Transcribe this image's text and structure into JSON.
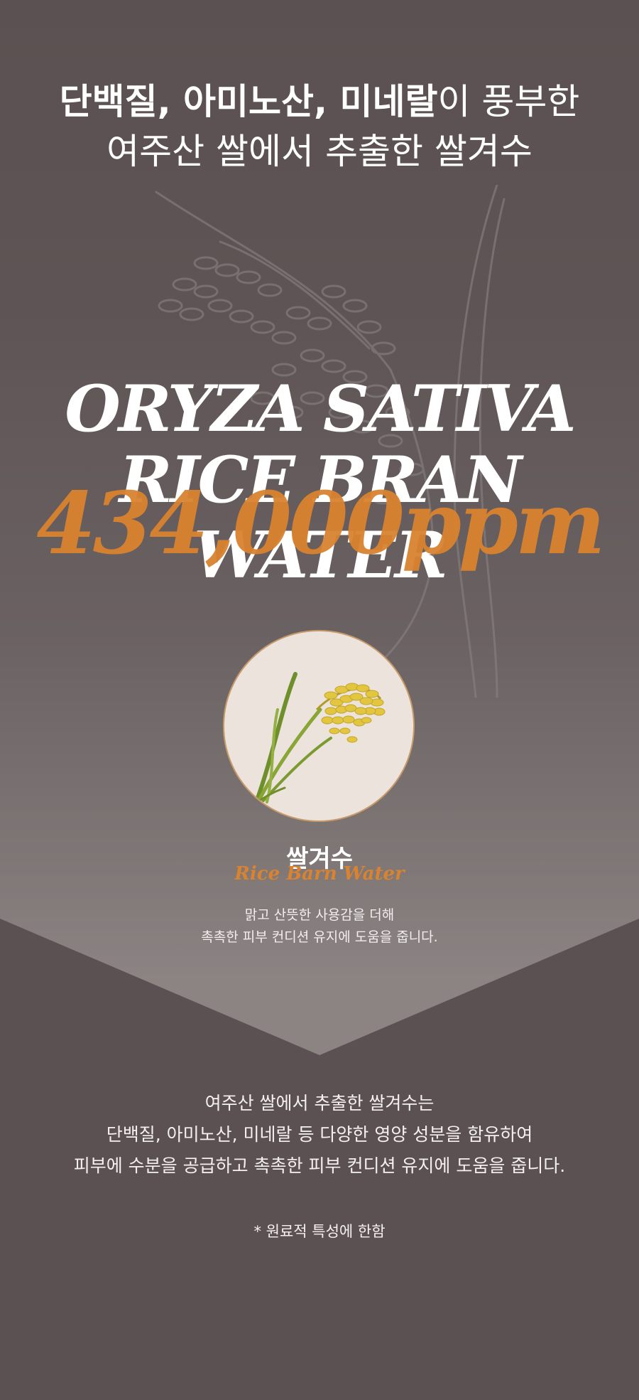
{
  "headline": {
    "line1_bold": "단백질, 아미노산, 미네랄",
    "line1_regular": "이 풍부한",
    "line2": "여주산 쌀에서 추출한 쌀겨수"
  },
  "title": {
    "line1": "ORYZA SATIVA",
    "line2": "RICE BRAN WATER",
    "ppm": "434,000ppm"
  },
  "product": {
    "name": "쌀겨수",
    "name_en": "Rice Barn Water",
    "desc_line1": "맑고 산뜻한 사용감을 더해",
    "desc_line2": "촉촉한 피부 컨디션 유지에 도움을 줍니다."
  },
  "body": {
    "line1": "여주산 쌀에서 추출한 쌀겨수는",
    "line2": "단백질, 아미노산, 미네랄 등 다양한 영양 성분을 함유하여",
    "line3": "피부에 수분을 공급하고 촉촉한 피부 컨디션 유지에 도움을 줍니다."
  },
  "note": "* 원료적 특성에 한함",
  "colors": {
    "background_dark": "#5b5152",
    "background_light": "#8b8483",
    "accent_orange": "#d9822f",
    "circle_bg": "#ece4dc"
  },
  "icons": {
    "rice_illustration": "rice-stalk-line-drawing",
    "rice_photo": "rice-plant-image"
  }
}
